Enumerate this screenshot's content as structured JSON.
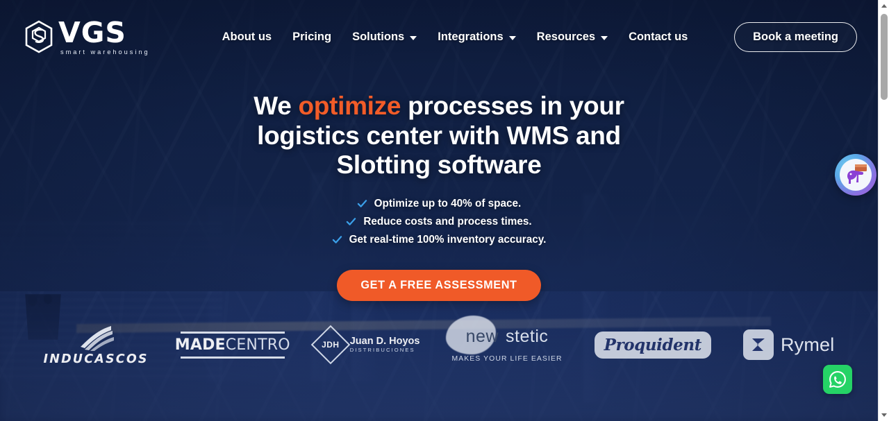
{
  "header": {
    "logo": {
      "mark_icon": "hexagon-box-icon",
      "word": "VGS",
      "tagline": "smart warehousing"
    },
    "nav": [
      {
        "label": "About us",
        "has_dropdown": false,
        "name": "nav-item-about-us"
      },
      {
        "label": "Pricing",
        "has_dropdown": false,
        "name": "nav-item-pricing"
      },
      {
        "label": "Solutions",
        "has_dropdown": true,
        "name": "nav-item-solutions"
      },
      {
        "label": "Integrations",
        "has_dropdown": true,
        "name": "nav-item-integrations"
      },
      {
        "label": "Resources",
        "has_dropdown": true,
        "name": "nav-item-resources"
      },
      {
        "label": "Contact us",
        "has_dropdown": false,
        "name": "nav-item-contact-us"
      }
    ],
    "book_button": "Book a meeting"
  },
  "hero": {
    "heading_part1": "We ",
    "heading_accent": "optimize",
    "heading_part2": " processes in your logistics center with WMS and Slotting software",
    "bullets": [
      "Optimize up to 40% of space.",
      "Reduce costs and process times.",
      "Get real-time 100% inventory accuracy."
    ],
    "cta_label": "GET A FREE ASSESSMENT"
  },
  "clients": {
    "heading": "",
    "logos": [
      {
        "name": "inducascos",
        "text": "INDUCASCOS"
      },
      {
        "name": "madecentro",
        "text_bold": "MADE",
        "text_light": "CENTRO"
      },
      {
        "name": "juan-d-hoyos",
        "monogram": "JDH",
        "title": "Juan D. Hoyos",
        "subtitle": "DISTRIBUCIONES"
      },
      {
        "name": "new-stetic",
        "word1": "new",
        "word2": "stetic",
        "tagline": "MAKES YOUR LIFE EASIER"
      },
      {
        "name": "proquident",
        "text": "Proquident"
      },
      {
        "name": "rymel",
        "text": "Rymel"
      }
    ]
  },
  "widgets": {
    "chat": {
      "icon": "chat-mascot-icon",
      "label": "Chat widget"
    },
    "whatsapp": {
      "icon": "whatsapp-icon",
      "label": "WhatsApp"
    }
  },
  "scrollbar": {
    "up_icon": "scroll-up-arrow-icon",
    "down_icon": "scroll-down-arrow-icon",
    "thumb": "scrollbar-thumb"
  },
  "colors": {
    "accent_orange": "#f05a28",
    "check_blue": "#3b9fe8",
    "bg_navy": "#16294f",
    "whatsapp_green": "#25d366"
  }
}
